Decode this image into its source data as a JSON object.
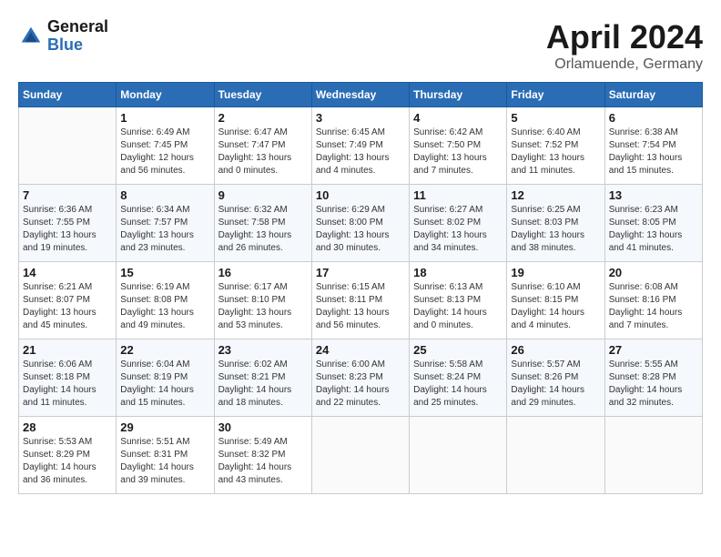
{
  "logo": {
    "line1": "General",
    "line2": "Blue"
  },
  "title": {
    "month_year": "April 2024",
    "location": "Orlamuende, Germany"
  },
  "weekdays": [
    "Sunday",
    "Monday",
    "Tuesday",
    "Wednesday",
    "Thursday",
    "Friday",
    "Saturday"
  ],
  "weeks": [
    [
      {
        "day": "",
        "info": ""
      },
      {
        "day": "1",
        "info": "Sunrise: 6:49 AM\nSunset: 7:45 PM\nDaylight: 12 hours\nand 56 minutes."
      },
      {
        "day": "2",
        "info": "Sunrise: 6:47 AM\nSunset: 7:47 PM\nDaylight: 13 hours\nand 0 minutes."
      },
      {
        "day": "3",
        "info": "Sunrise: 6:45 AM\nSunset: 7:49 PM\nDaylight: 13 hours\nand 4 minutes."
      },
      {
        "day": "4",
        "info": "Sunrise: 6:42 AM\nSunset: 7:50 PM\nDaylight: 13 hours\nand 7 minutes."
      },
      {
        "day": "5",
        "info": "Sunrise: 6:40 AM\nSunset: 7:52 PM\nDaylight: 13 hours\nand 11 minutes."
      },
      {
        "day": "6",
        "info": "Sunrise: 6:38 AM\nSunset: 7:54 PM\nDaylight: 13 hours\nand 15 minutes."
      }
    ],
    [
      {
        "day": "7",
        "info": "Sunrise: 6:36 AM\nSunset: 7:55 PM\nDaylight: 13 hours\nand 19 minutes."
      },
      {
        "day": "8",
        "info": "Sunrise: 6:34 AM\nSunset: 7:57 PM\nDaylight: 13 hours\nand 23 minutes."
      },
      {
        "day": "9",
        "info": "Sunrise: 6:32 AM\nSunset: 7:58 PM\nDaylight: 13 hours\nand 26 minutes."
      },
      {
        "day": "10",
        "info": "Sunrise: 6:29 AM\nSunset: 8:00 PM\nDaylight: 13 hours\nand 30 minutes."
      },
      {
        "day": "11",
        "info": "Sunrise: 6:27 AM\nSunset: 8:02 PM\nDaylight: 13 hours\nand 34 minutes."
      },
      {
        "day": "12",
        "info": "Sunrise: 6:25 AM\nSunset: 8:03 PM\nDaylight: 13 hours\nand 38 minutes."
      },
      {
        "day": "13",
        "info": "Sunrise: 6:23 AM\nSunset: 8:05 PM\nDaylight: 13 hours\nand 41 minutes."
      }
    ],
    [
      {
        "day": "14",
        "info": "Sunrise: 6:21 AM\nSunset: 8:07 PM\nDaylight: 13 hours\nand 45 minutes."
      },
      {
        "day": "15",
        "info": "Sunrise: 6:19 AM\nSunset: 8:08 PM\nDaylight: 13 hours\nand 49 minutes."
      },
      {
        "day": "16",
        "info": "Sunrise: 6:17 AM\nSunset: 8:10 PM\nDaylight: 13 hours\nand 53 minutes."
      },
      {
        "day": "17",
        "info": "Sunrise: 6:15 AM\nSunset: 8:11 PM\nDaylight: 13 hours\nand 56 minutes."
      },
      {
        "day": "18",
        "info": "Sunrise: 6:13 AM\nSunset: 8:13 PM\nDaylight: 14 hours\nand 0 minutes."
      },
      {
        "day": "19",
        "info": "Sunrise: 6:10 AM\nSunset: 8:15 PM\nDaylight: 14 hours\nand 4 minutes."
      },
      {
        "day": "20",
        "info": "Sunrise: 6:08 AM\nSunset: 8:16 PM\nDaylight: 14 hours\nand 7 minutes."
      }
    ],
    [
      {
        "day": "21",
        "info": "Sunrise: 6:06 AM\nSunset: 8:18 PM\nDaylight: 14 hours\nand 11 minutes."
      },
      {
        "day": "22",
        "info": "Sunrise: 6:04 AM\nSunset: 8:19 PM\nDaylight: 14 hours\nand 15 minutes."
      },
      {
        "day": "23",
        "info": "Sunrise: 6:02 AM\nSunset: 8:21 PM\nDaylight: 14 hours\nand 18 minutes."
      },
      {
        "day": "24",
        "info": "Sunrise: 6:00 AM\nSunset: 8:23 PM\nDaylight: 14 hours\nand 22 minutes."
      },
      {
        "day": "25",
        "info": "Sunrise: 5:58 AM\nSunset: 8:24 PM\nDaylight: 14 hours\nand 25 minutes."
      },
      {
        "day": "26",
        "info": "Sunrise: 5:57 AM\nSunset: 8:26 PM\nDaylight: 14 hours\nand 29 minutes."
      },
      {
        "day": "27",
        "info": "Sunrise: 5:55 AM\nSunset: 8:28 PM\nDaylight: 14 hours\nand 32 minutes."
      }
    ],
    [
      {
        "day": "28",
        "info": "Sunrise: 5:53 AM\nSunset: 8:29 PM\nDaylight: 14 hours\nand 36 minutes."
      },
      {
        "day": "29",
        "info": "Sunrise: 5:51 AM\nSunset: 8:31 PM\nDaylight: 14 hours\nand 39 minutes."
      },
      {
        "day": "30",
        "info": "Sunrise: 5:49 AM\nSunset: 8:32 PM\nDaylight: 14 hours\nand 43 minutes."
      },
      {
        "day": "",
        "info": ""
      },
      {
        "day": "",
        "info": ""
      },
      {
        "day": "",
        "info": ""
      },
      {
        "day": "",
        "info": ""
      }
    ]
  ]
}
